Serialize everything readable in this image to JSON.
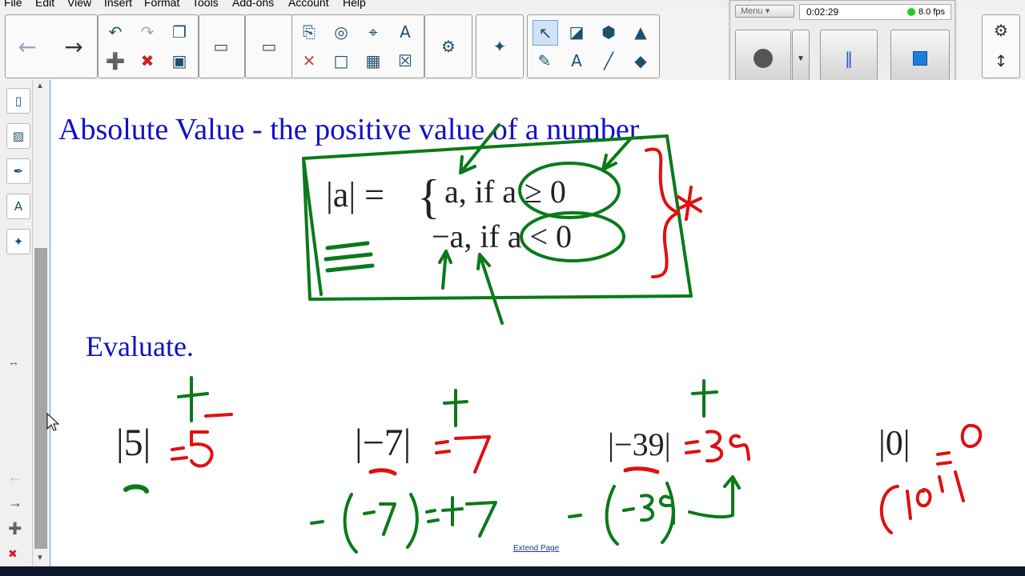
{
  "menubar": {
    "items": [
      "File",
      "Edit",
      "View",
      "Insert",
      "Format",
      "Tools",
      "Add-ons",
      "Account",
      "Help"
    ]
  },
  "recorder": {
    "menu_label": "Menu",
    "timer": "0:02:29",
    "fps": "8.0 fps",
    "status_color": "#22cc22",
    "buttons": [
      "record-icon",
      "dropdown-icon",
      "pause-icon",
      "stop-icon"
    ]
  },
  "toolbar": {
    "icons": [
      "back-arrow-icon",
      "forward-arrow-icon",
      "undo-icon",
      "redo-icon",
      "screen-icon",
      "add-page-icon",
      "delete-page-icon",
      "save-icon",
      "display-icon",
      "screen-shade-icon",
      "paste-icon",
      "camera-icon",
      "doc-camera-icon",
      "text-format-icon",
      "delete-icon",
      "table-icon",
      "clear-icon",
      "addon-robot-icon",
      "puzzle-icon",
      "select-icon",
      "shape-icon",
      "fill-icon",
      "pen-icon",
      "text-icon",
      "line-icon",
      "eraser-icon",
      "gear-icon",
      "move-toolbar-icon"
    ]
  },
  "sidebar": {
    "tabs": [
      "page-sorter-icon",
      "gallery-icon",
      "attachments-icon",
      "properties-icon",
      "addons-icon"
    ]
  },
  "canvas": {
    "title": "Absolute Value - the positive value of a number.",
    "evaluate_label": "Evaluate.",
    "formula": {
      "lhs": "|a| = ",
      "case1": "a, if a ≥ 0",
      "case2": "−a, if a < 0"
    },
    "problems": [
      "|5|",
      "|−7|",
      "|−39|",
      "|0|"
    ],
    "extend_link": "Extend Page"
  },
  "colors": {
    "title_blue": "#1010c8",
    "ink_green": "#0a7a1a",
    "ink_red": "#e01010"
  }
}
